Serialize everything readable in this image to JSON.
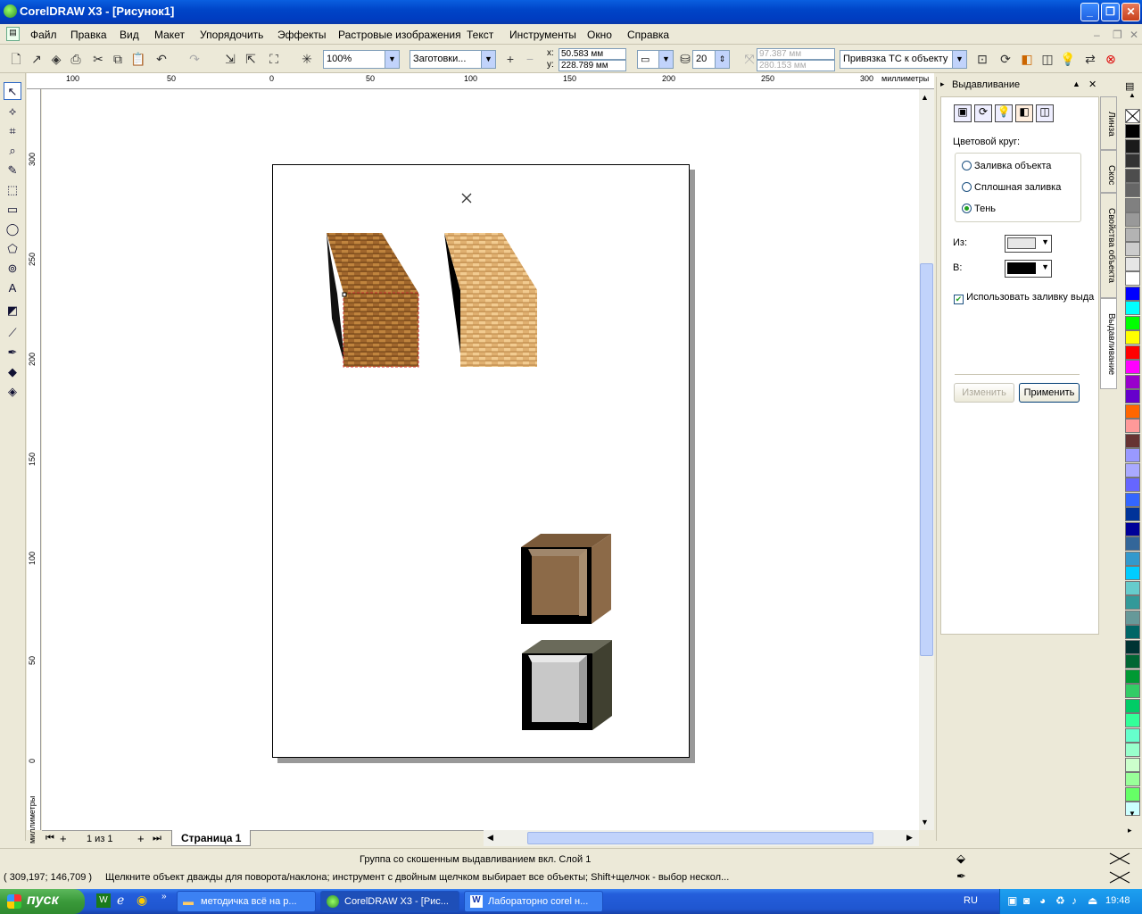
{
  "window": {
    "title": "CorelDRAW X3 - [Рисунок1]"
  },
  "menu": [
    "Файл",
    "Правка",
    "Вид",
    "Макет",
    "Упорядочить",
    "Эффекты",
    "Растровые изображения",
    "Текст",
    "Инструменты",
    "Окно",
    "Справка"
  ],
  "toolbar": {
    "zoom": "100%",
    "presets": "Заготовки...",
    "x_label": "x:",
    "x_value": "50.583 мм",
    "y_label": "y:",
    "y_value": "228.789 мм",
    "depth": "20",
    "vp_x": "97.387 мм",
    "vp_y": "280.153 мм",
    "vp_lock": "Привязка ТС к объекту"
  },
  "ruler": {
    "units": "миллиметры",
    "h_ticks": [
      "100",
      "50",
      "0",
      "50",
      "100",
      "150",
      "200",
      "250",
      "300"
    ],
    "v_ticks": [
      "300",
      "250",
      "200",
      "150",
      "100",
      "50",
      "0"
    ]
  },
  "pages": {
    "counter": "1 из 1",
    "tab": "Страница 1"
  },
  "docker": {
    "title": "Выдавливание",
    "color_label": "Цветовой круг:",
    "options": [
      "Заливка объекта",
      "Сплошная заливка",
      "Тень"
    ],
    "selected": "Тень",
    "from_label": "Из:",
    "to_label": "В:",
    "from_color": "#e6e6e6",
    "to_color": "#000000",
    "use_fill": "Использовать заливку выда",
    "edit_btn": "Изменить",
    "apply_btn": "Применить",
    "tabs": [
      "Линза",
      "Скос",
      "Свойства объекта",
      "Выдавливание"
    ]
  },
  "status": {
    "selection": "Группа со скошенным выдавливанием вкл. Слой 1",
    "coords": "( 309,197; 146,709 )",
    "hint": "Щелкните объект дважды для поворота/наклона; инструмент с двойным щелчком выбирает все объекты; Shift+щелчок - выбор нескол..."
  },
  "taskbar": {
    "start": "пуск",
    "tasks": [
      "методичка всё на р...",
      "CorelDRAW X3 - [Рис...",
      "Лабораторно corel н..."
    ],
    "lang": "RU",
    "clock": "19:48"
  },
  "palette": [
    "#ffffff",
    "#000000",
    "#1a1a1a",
    "#333333",
    "#4d4d4d",
    "#666666",
    "#808080",
    "#999999",
    "#b3b3b3",
    "#cccccc",
    "#e6e6e6",
    "#ffffff",
    "#0000ff",
    "#00ffff",
    "#00ff00",
    "#ffff00",
    "#ff0000",
    "#ff00ff",
    "#9900cc",
    "#6600cc",
    "#ff6600",
    "#ff9999",
    "#663333",
    "#9999ff",
    "#aaaaff",
    "#6666ff",
    "#3366ff",
    "#003399",
    "#000099",
    "#336699",
    "#3399cc",
    "#00ccff",
    "#66cccc",
    "#339999",
    "#669999",
    "#006666",
    "#003333",
    "#006633",
    "#009933",
    "#33cc66",
    "#00cc66",
    "#33ff99",
    "#66ffcc",
    "#99ffcc",
    "#ccffcc",
    "#99ff99",
    "#66ff66",
    "#ccffff"
  ]
}
